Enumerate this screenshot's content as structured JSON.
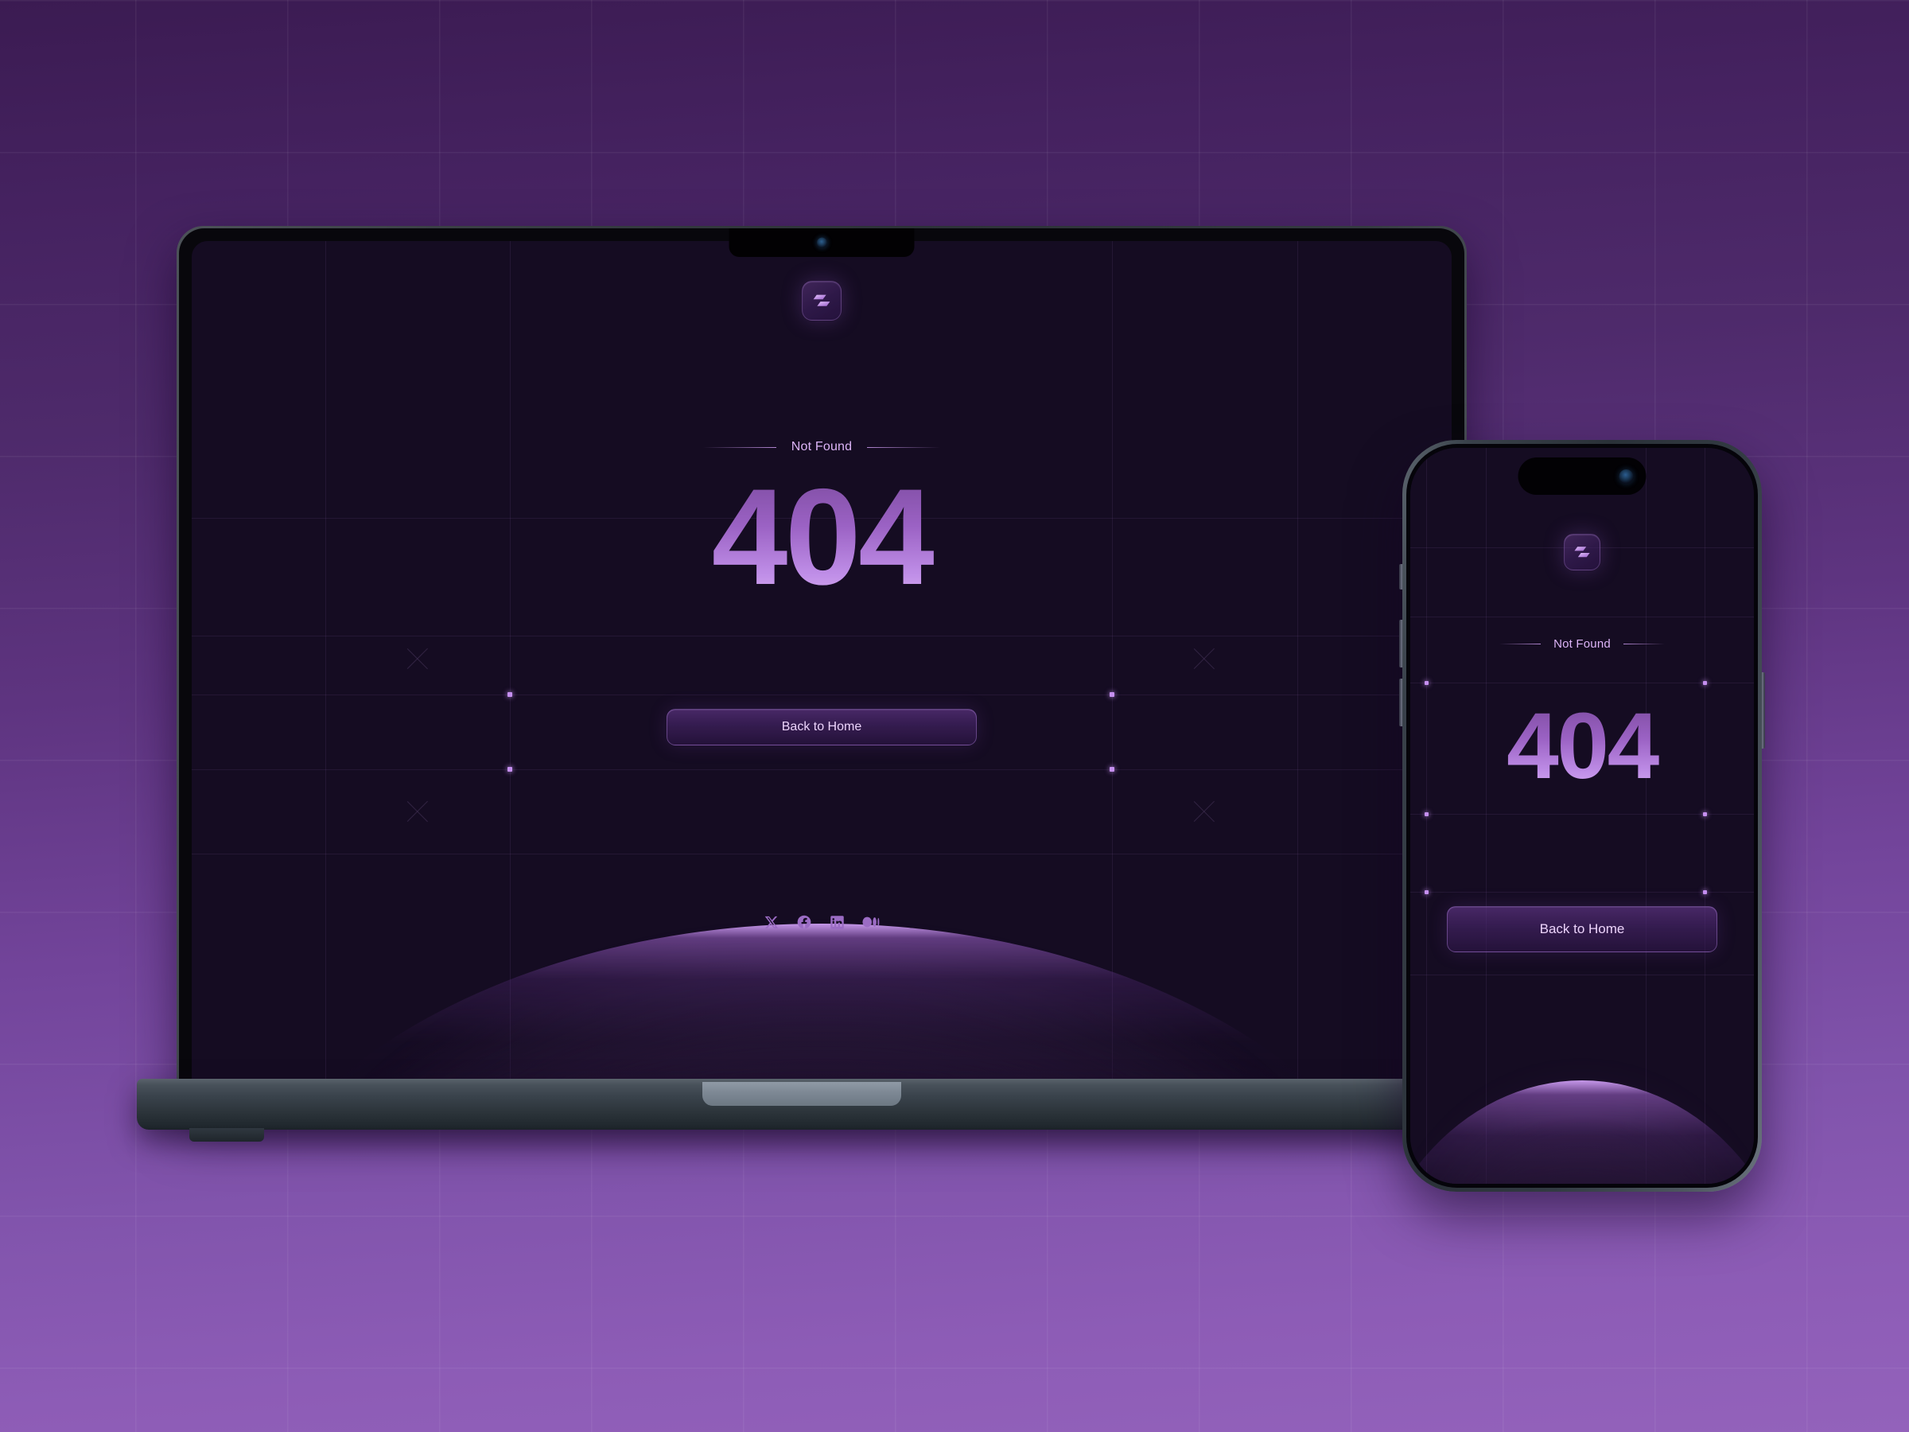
{
  "scene": {
    "title": "404 Not Found page mockup on laptop and phone",
    "background_color_top": "#3b1b52",
    "background_color_bottom": "#9362bb",
    "accent_color": "#c58ff0"
  },
  "page": {
    "eyebrow": "Not Found",
    "error_code": "404",
    "cta_label": "Back to Home",
    "logo": {
      "name": "brand-logo-mark",
      "shape": "stacked-parallelogram-lightning",
      "color": "#c79aec"
    },
    "socials": [
      {
        "name": "x-twitter-icon",
        "label": "X"
      },
      {
        "name": "facebook-icon",
        "label": "Facebook"
      },
      {
        "name": "linkedin-icon",
        "label": "LinkedIn"
      },
      {
        "name": "medium-icon",
        "label": "Medium"
      }
    ]
  },
  "devices": {
    "laptop": {
      "name": "laptop-mockup",
      "label": "Laptop"
    },
    "phone": {
      "name": "phone-mockup",
      "label": "Phone"
    }
  }
}
